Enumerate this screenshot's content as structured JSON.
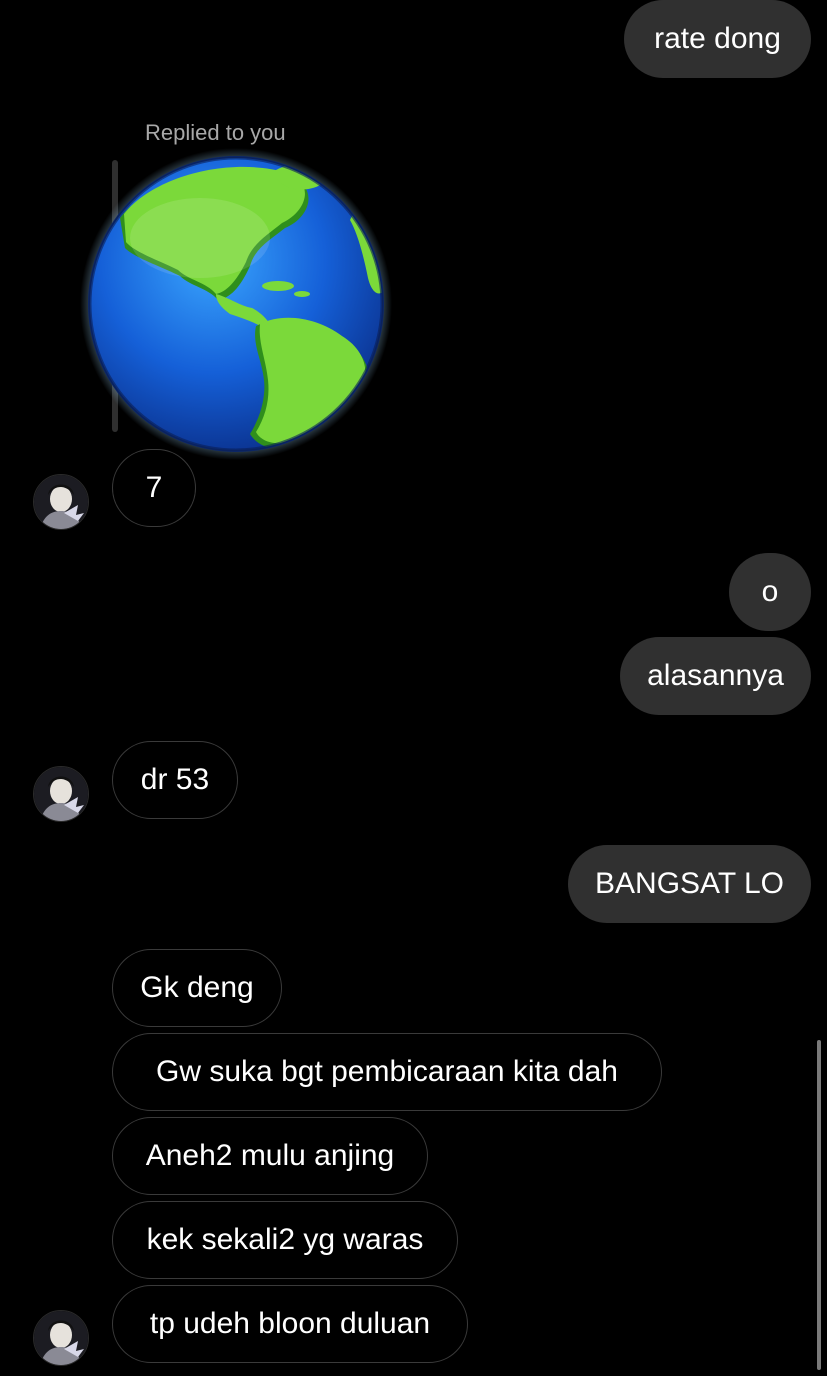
{
  "chat": {
    "messages": [
      {
        "side": "sent",
        "text": "rate dong"
      },
      {
        "side": "sent",
        "text": "o"
      },
      {
        "side": "sent",
        "text": "alasannya"
      },
      {
        "side": "sent",
        "text": "BANGSAT LO"
      },
      {
        "side": "received",
        "text": "7"
      },
      {
        "side": "received",
        "text": "dr 53"
      },
      {
        "side": "received",
        "text": "Gk deng"
      },
      {
        "side": "received",
        "text": "Gw suka bgt pembicaraan kita dah"
      },
      {
        "side": "received",
        "text": "Aneh2 mulu anjing"
      },
      {
        "side": "received",
        "text": "kek sekali2 yg waras"
      },
      {
        "side": "received",
        "text": "tp udeh bloon duluan"
      }
    ],
    "reply": {
      "label": "Replied to you",
      "sticker_icon": "globe-americas-icon"
    }
  },
  "colors": {
    "background": "#000000",
    "sent_bubble": "#303030",
    "received_border": "#3a3a3a",
    "secondary_text": "#a8a8a8"
  }
}
